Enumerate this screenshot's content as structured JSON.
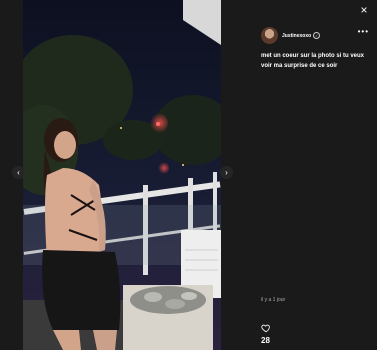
{
  "colors": {
    "background": "#1b1b1b",
    "text": "#ffffff",
    "muted": "#aaaaaa"
  },
  "post": {
    "author": "Justinexoxo",
    "caption": "met un coeur sur la photo si tu veux voir ma surprise de ce soir",
    "timestamp": "il y a 1 jour",
    "likes": "28"
  },
  "icons": {
    "close": "×",
    "prev": "‹",
    "next": "›",
    "more": "•••",
    "verified": "✓"
  }
}
